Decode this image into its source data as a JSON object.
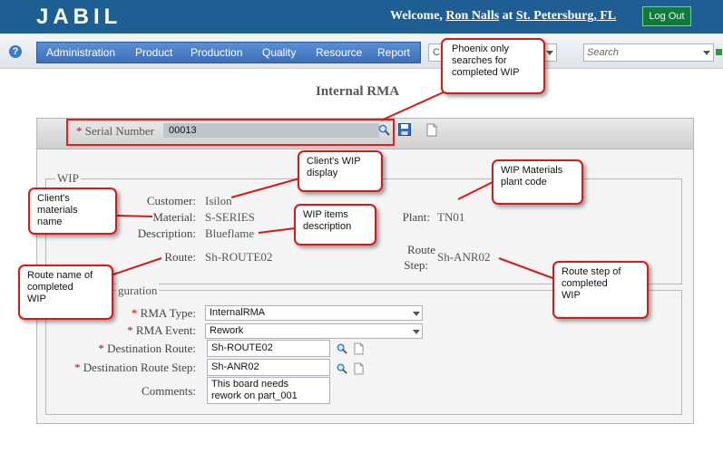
{
  "header": {
    "logo": "JABIL",
    "welcome_prefix": "Welcome,",
    "user_name": "Ron Nalls",
    "at": "at",
    "location": "St. Petersburg, FL",
    "logout_label": "Log Out"
  },
  "toolbar": {
    "help_icon": "?",
    "menu": [
      "Administration",
      "Product",
      "Production",
      "Quality",
      "Resource",
      "Report"
    ],
    "combo_value": "C",
    "search_placeholder": "Search"
  },
  "page_title": "Internal RMA",
  "serial": {
    "label": "Serial Number",
    "required_mark": "*",
    "value": "00013"
  },
  "wip": {
    "legend": "WIP",
    "customer_label": "Customer:",
    "customer_value": "Isilon",
    "material_label": "Material:",
    "material_value": "S-SERIES",
    "description_label": "Description:",
    "description_value": "Blueflame",
    "plant_label": "Plant:",
    "plant_value": "TN01",
    "route_label": "Route:",
    "route_value": "Sh-ROUTE02",
    "route_step_label_line1": "Route",
    "route_step_label_line2": "Step:",
    "route_step_value": "Sh-ANR02"
  },
  "configuration": {
    "legend": "guration",
    "rma_type_label": "RMA Type:",
    "rma_type_value": "InternalRMA",
    "rma_event_label": "RMA Event:",
    "rma_event_value": "Rework",
    "dest_route_label": "Destination Route:",
    "dest_route_value": "Sh-ROUTE02",
    "dest_route_step_label": "Destination Route Step:",
    "dest_route_step_value": "Sh-ANR02",
    "comments_label": "Comments:",
    "comments_line1": "This board needs",
    "comments_line2": "rework on part_001"
  },
  "annotations": {
    "phoenix": [
      "Phoenix only",
      "searches for",
      "completed WIP"
    ],
    "client_wip": [
      "Client's WIP",
      "display"
    ],
    "wip_materials": [
      "WIP Materials",
      "plant code"
    ],
    "client_materials": [
      "Client's",
      "materials",
      "name"
    ],
    "wip_items": [
      "WIP items",
      "description"
    ],
    "route_name": [
      "Route name of",
      "completed",
      "WIP"
    ],
    "route_step": [
      "Route step  of",
      "completed",
      "WIP"
    ]
  },
  "colors": {
    "header_bg": "#1f5e93",
    "menu_bg": "#3d6fb8",
    "annotation_border": "#d61a1a",
    "logout_bg": "#0e7a3c"
  }
}
